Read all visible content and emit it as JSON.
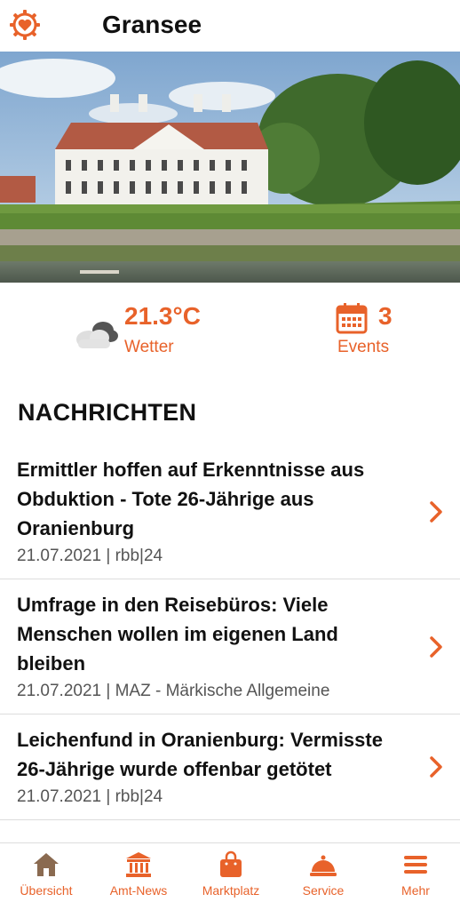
{
  "header": {
    "title": "Gransee",
    "logo_icon": "heart-gear-logo-icon"
  },
  "info": {
    "temperature": "21.3°C",
    "weather_label": "Wetter",
    "weather_icon": "cloud-icon",
    "events_count": "3",
    "events_label": "Events",
    "events_icon": "calendar-icon"
  },
  "news": {
    "section_title": "NACHRICHTEN",
    "items": [
      {
        "headline": "Ermittler hoffen auf Erkenntnisse aus Obduktion - Tote 26-Jährige aus Oranienburg",
        "meta": "21.07.2021 | rbb|24"
      },
      {
        "headline": "Umfrage in den Reisebüros: Viele Menschen wollen im eigenen Land bleiben",
        "meta": "21.07.2021 | MAZ - Märkische Allgemeine"
      },
      {
        "headline": "Leichenfund in Oranienburg: Vermisste 26-Jährige wurde offenbar getötet",
        "meta": "21.07.2021 | rbb|24"
      }
    ]
  },
  "tabs": [
    {
      "label": "Übersicht",
      "icon": "home-icon"
    },
    {
      "label": "Amt-News",
      "icon": "building-icon"
    },
    {
      "label": "Marktplatz",
      "icon": "shopping-bag-icon"
    },
    {
      "label": "Service",
      "icon": "service-bell-icon"
    },
    {
      "label": "Mehr",
      "icon": "menu-icon"
    }
  ],
  "colors": {
    "accent": "#e8622a"
  }
}
